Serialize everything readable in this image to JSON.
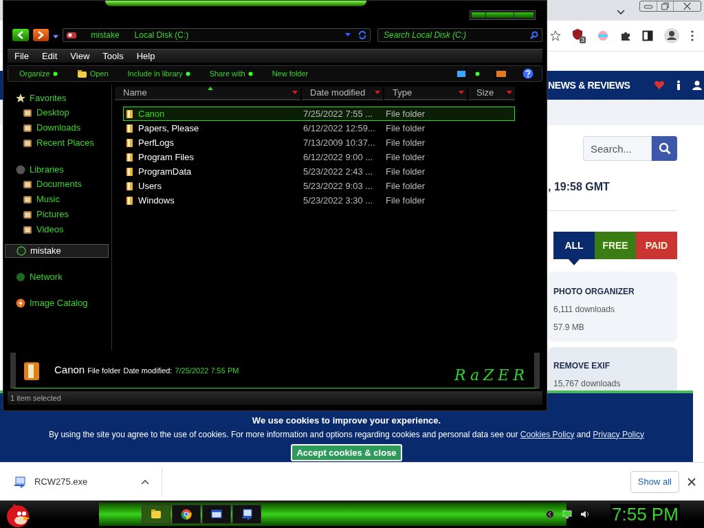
{
  "browser": {
    "extension_badge": "3",
    "site_nav": "NEWS & REVIEWS",
    "search": {
      "placeholder": "Search..."
    },
    "timestamp": ", 19:58 GMT",
    "filter_tabs": [
      {
        "label": "ALL",
        "selected": true,
        "color": "#0a2a6e"
      },
      {
        "label": "FREE",
        "selected": false,
        "color": "#3a7d14"
      },
      {
        "label": "PAID",
        "selected": false,
        "color": "#cc3333"
      }
    ],
    "apps": [
      {
        "title": "PHOTO ORGANIZER",
        "downloads": "6,111 downloads",
        "size": "57.9 MB"
      },
      {
        "title": "REMOVE EXIF",
        "downloads": "15,767 downloads"
      }
    ],
    "cookie_banner": {
      "heading": "We use cookies to improve your experience.",
      "text": "By using the site you agree to the use of cookies. For more information and options regarding cookies and personal data see our",
      "links": [
        "Cookies Policy",
        "Privacy Policy"
      ],
      "joiner": "and",
      "button": "Accept cookies & close"
    },
    "downloads_bar": {
      "file": "RCW275.exe",
      "button": "Show all"
    }
  },
  "explorer": {
    "address": [
      "mistake",
      "Local Disk (C:)"
    ],
    "search": {
      "placeholder": "Search Local Disk (C:)"
    },
    "menu": [
      "File",
      "Edit",
      "View",
      "Tools",
      "Help"
    ],
    "commands": [
      {
        "label": "Organize",
        "kind": "dropdown"
      },
      {
        "label": "Open",
        "kind": "open"
      },
      {
        "label": "Include in library",
        "kind": "dropdown"
      },
      {
        "label": "Share with",
        "kind": "dropdown"
      },
      {
        "label": "New folder",
        "kind": "plain"
      }
    ],
    "nav": [
      {
        "label": "Favorites",
        "kind": "star",
        "selected": false,
        "children": [
          {
            "label": "Desktop"
          },
          {
            "label": "Downloads"
          },
          {
            "label": "Recent Places"
          }
        ]
      },
      {
        "label": "Libraries",
        "kind": "library",
        "selected": false,
        "children": [
          {
            "label": "Documents"
          },
          {
            "label": "Music"
          },
          {
            "label": "Pictures"
          },
          {
            "label": "Videos"
          }
        ]
      },
      {
        "label": "mistake",
        "kind": "user",
        "selected": true
      },
      {
        "label": "Network",
        "kind": "network",
        "selected": false
      },
      {
        "label": "Image Catalog",
        "kind": "catalog",
        "selected": false
      }
    ],
    "columns": [
      {
        "label": "Name",
        "sorted": true
      },
      {
        "label": "Date modified",
        "sorted": false
      },
      {
        "label": "Type",
        "sorted": false
      },
      {
        "label": "Size",
        "sorted": false
      }
    ],
    "rows": [
      {
        "name": "Canon",
        "date": "7/25/2022 7:55 ...",
        "type": "File folder",
        "selected": true
      },
      {
        "name": "Papers, Please",
        "date": "6/12/2022 12:59...",
        "type": "File folder",
        "selected": false
      },
      {
        "name": "PerfLogs",
        "date": "7/13/2009 10:37...",
        "type": "File folder",
        "selected": false
      },
      {
        "name": "Program Files",
        "date": "6/12/2022 9:00 ...",
        "type": "File folder",
        "selected": false
      },
      {
        "name": "ProgramData",
        "date": "5/23/2022 2:43 ...",
        "type": "File folder",
        "selected": false
      },
      {
        "name": "Users",
        "date": "5/23/2022 9:03 ...",
        "type": "File folder",
        "selected": false
      },
      {
        "name": "Windows",
        "date": "5/23/2022 3:30 ...",
        "type": "File folder",
        "selected": false
      }
    ],
    "details": {
      "name": "Canon",
      "type": "File folder",
      "date_label": "Date modified:",
      "date": "7/25/2022 7:55 PM"
    },
    "brand": "RaZER",
    "status": "1 item selected"
  },
  "taskbar": {
    "apps": [
      {
        "kind": "folder",
        "selected": true
      },
      {
        "kind": "browser",
        "selected": false
      },
      {
        "kind": "window",
        "selected": false
      },
      {
        "kind": "installer",
        "selected": false
      }
    ],
    "clock": "7:55 PM"
  }
}
